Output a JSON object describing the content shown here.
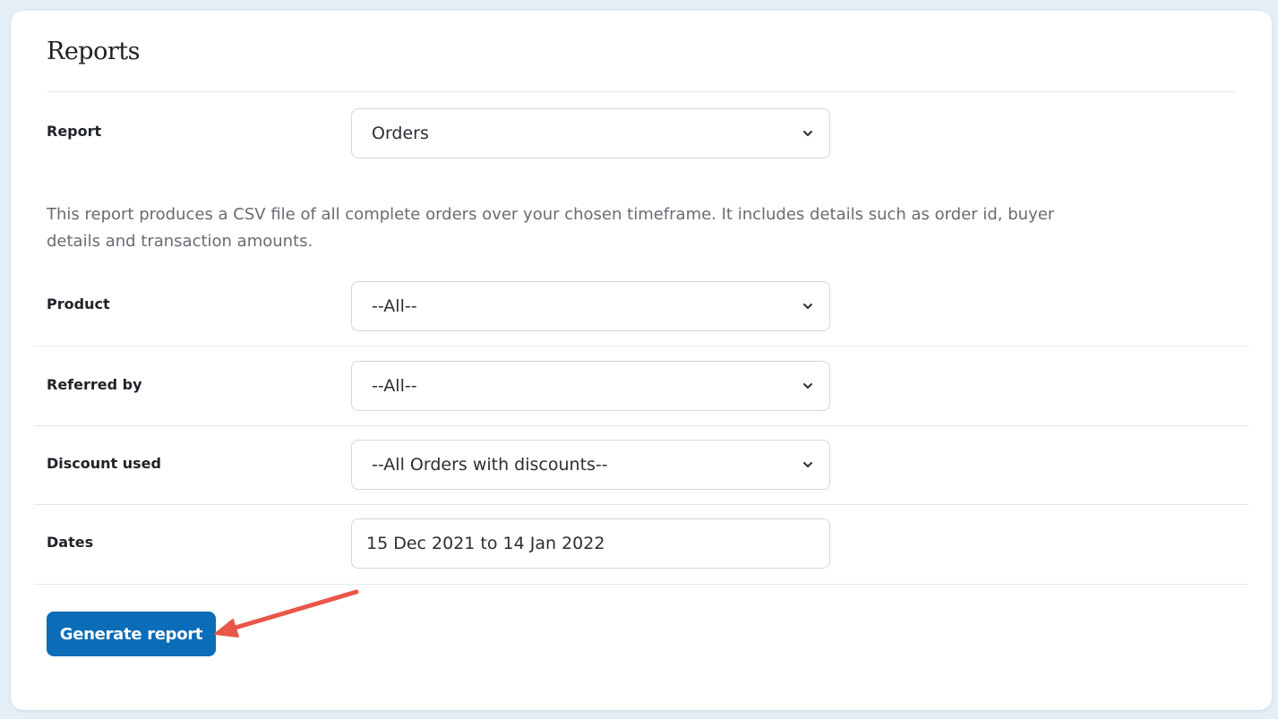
{
  "page": {
    "title": "Reports"
  },
  "form": {
    "report": {
      "label": "Report",
      "value": "Orders"
    },
    "description": "This report produces a CSV file of all complete orders over your chosen timeframe. It includes details such as order id, buyer details and transaction amounts.",
    "product": {
      "label": "Product",
      "value": "--All--"
    },
    "referred_by": {
      "label": "Referred by",
      "value": "--All--"
    },
    "discount_used": {
      "label": "Discount used",
      "value": "--All Orders with discounts--"
    },
    "dates": {
      "label": "Dates",
      "value": "15 Dec 2021 to 14 Jan 2022"
    }
  },
  "actions": {
    "generate_label": "Generate report"
  },
  "annotation": {
    "arrow_color": "#e8574a"
  },
  "colors": {
    "accent": "#0b6cb8",
    "background": "#e4eef6"
  }
}
